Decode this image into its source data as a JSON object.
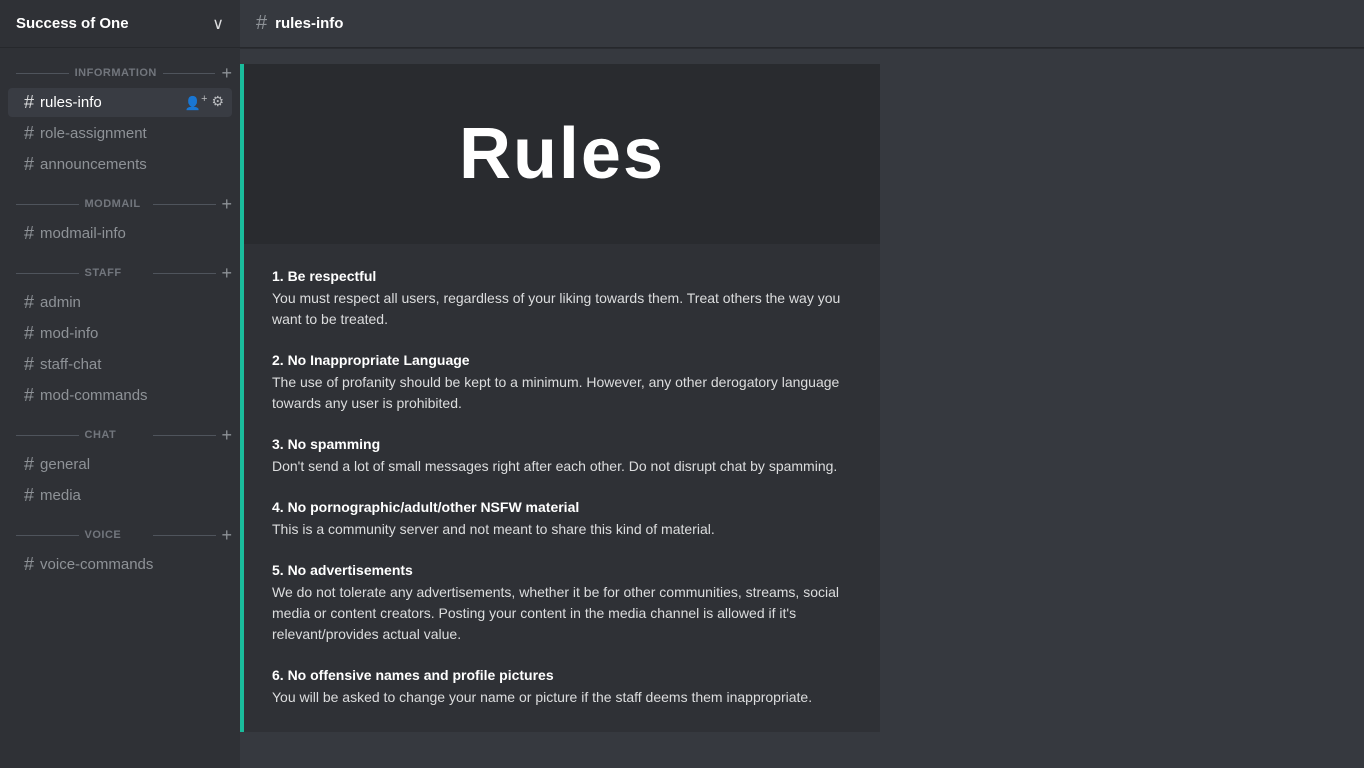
{
  "server": {
    "name": "Success of One",
    "chevron": "∨"
  },
  "header": {
    "hash": "#",
    "channel_name": "rules-info"
  },
  "sidebar": {
    "sections": [
      {
        "label": "INFORMATION",
        "show_add": true,
        "channels": [
          {
            "name": "rules-info",
            "active": true
          },
          {
            "name": "role-assignment",
            "active": false
          },
          {
            "name": "announcements",
            "active": false
          }
        ]
      },
      {
        "label": "MODMAIL",
        "show_add": true,
        "channels": [
          {
            "name": "modmail-info",
            "active": false
          }
        ]
      },
      {
        "label": "STAFF",
        "show_add": true,
        "channels": [
          {
            "name": "admin",
            "active": false
          },
          {
            "name": "mod-info",
            "active": false
          },
          {
            "name": "staff-chat",
            "active": false
          },
          {
            "name": "mod-commands",
            "active": false
          }
        ]
      },
      {
        "label": "CHAT",
        "show_add": true,
        "channels": [
          {
            "name": "general",
            "active": false
          },
          {
            "name": "media",
            "active": false
          }
        ]
      },
      {
        "label": "VOICE",
        "show_add": true,
        "channels": [
          {
            "name": "voice-commands",
            "active": false
          }
        ]
      }
    ]
  },
  "rules": {
    "banner_title": "Rules",
    "items": [
      {
        "title": "1. Be respectful",
        "body": "You must respect all users, regardless of your liking towards them. Treat others the way you want to be treated."
      },
      {
        "title": "2. No Inappropriate Language",
        "body": "The use of profanity should be kept to a minimum. However, any other derogatory language towards any user is prohibited."
      },
      {
        "title": "3. No spamming",
        "body": "Don't send a lot of small messages right after each other. Do not disrupt chat by spamming."
      },
      {
        "title": "4. No pornographic/adult/other NSFW material",
        "body": "This is a community server and not meant to share this kind of material."
      },
      {
        "title": "5. No advertisements",
        "body": "We do not tolerate any advertisements, whether it be for other communities, streams, social media or content creators. Posting your content in the media channel is allowed if it's relevant/provides actual value."
      },
      {
        "title": "6. No offensive names and profile pictures",
        "body": "You will be asked to change your name or picture if the staff deems them inappropriate."
      }
    ]
  },
  "icons": {
    "add": "+",
    "add_member": "👤+",
    "settings": "⚙"
  }
}
